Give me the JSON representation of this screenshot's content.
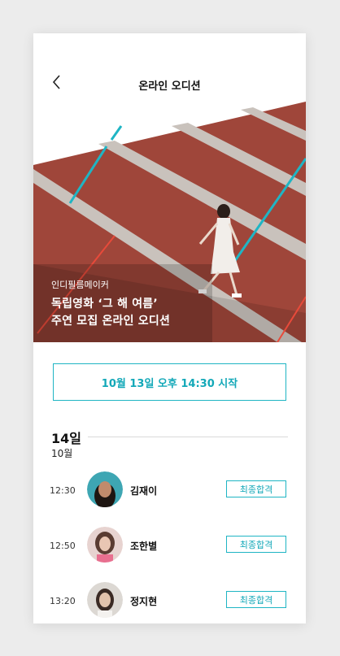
{
  "header": {
    "title": "온라인 오디션",
    "back_icon": "chevron-left-icon"
  },
  "hero": {
    "subtitle": "인디필름메이커",
    "headline_line1": "독립영화 ‘그 해 여름’",
    "headline_line2": "주연 모집 온라인 오디션"
  },
  "cta": {
    "label": "10월 13일 오후 14:30 시작"
  },
  "schedule": {
    "day": "14일",
    "month": "10월",
    "items": [
      {
        "time": "12:30",
        "name": "김재이",
        "status": "최종합격"
      },
      {
        "time": "12:50",
        "name": "조한별",
        "status": "최종합격"
      },
      {
        "time": "13:20",
        "name": "정지현",
        "status": "최종합격"
      }
    ]
  },
  "colors": {
    "accent": "#1fb5c4",
    "track": "#a44a3c",
    "lane": "#c9c2bc",
    "stripe_red": "#e84a3a"
  }
}
